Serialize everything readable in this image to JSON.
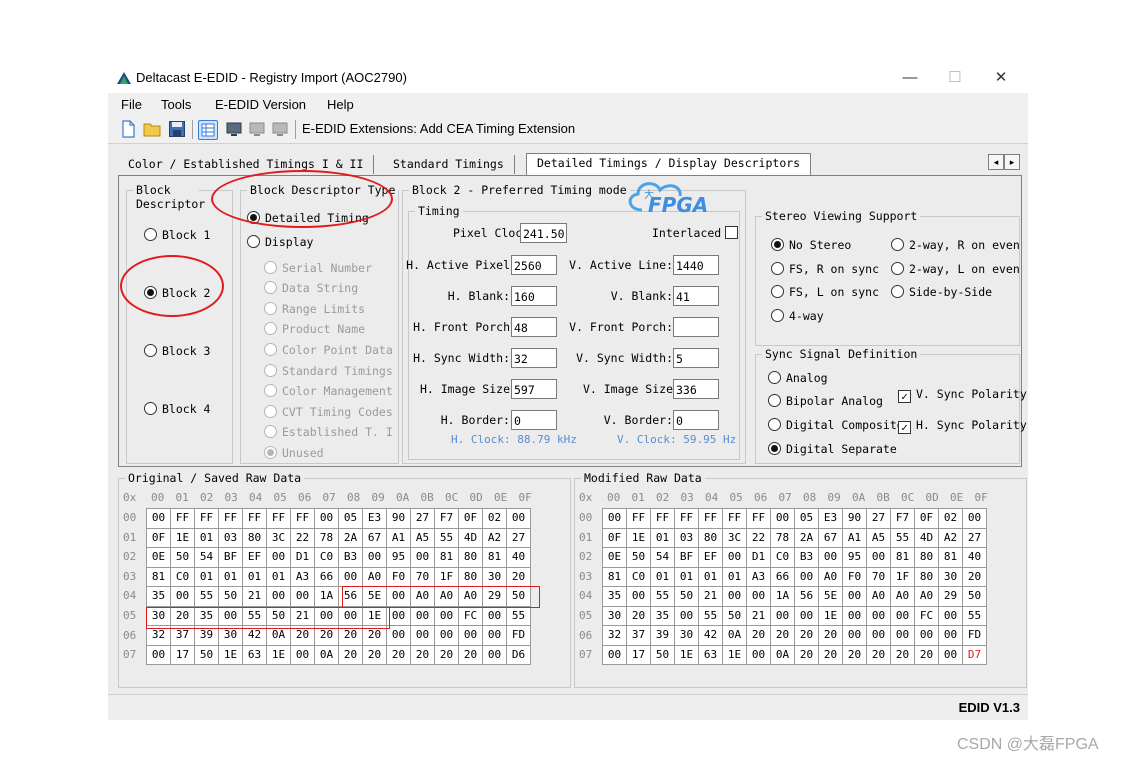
{
  "window": {
    "title": "Deltacast E-EDID - Registry Import (AOC2790)",
    "controls": {
      "minimize": "—",
      "maximize": "☐",
      "close": "✕"
    }
  },
  "menu": [
    "File",
    "Tools",
    "E-EDID Version",
    "Help"
  ],
  "toolbar": {
    "icons": [
      "new-file-icon",
      "open-folder-icon",
      "save-icon",
      "grid-view-icon",
      "monitor-icon",
      "display-grey-icon",
      "display-grey-icon"
    ],
    "extensions_label": "E-EDID Extensions:  Add CEA Timing Extension"
  },
  "tabs": [
    "Color / Established Timings I & II",
    "Standard Timings",
    "Detailed Timings / Display Descriptors"
  ],
  "active_tab": "Detailed Timings / Display Descriptors",
  "block_group": {
    "title": "Block Descriptor",
    "options": [
      "Block 1",
      "Block 2",
      "Block 3",
      "Block 4"
    ],
    "selected": "Block 2"
  },
  "descriptor_type": {
    "title": "Block Descriptor Type",
    "detailed": "Detailed Timing",
    "display": "Display",
    "display_options": [
      "Serial Number",
      "Data String",
      "Range Limits",
      "Product Name",
      "Color Point Data",
      "Standard Timings",
      "Color Management",
      "CVT Timing Codes",
      "Established T. II",
      "Unused"
    ],
    "selected_display": "Unused"
  },
  "block2": {
    "title": "Block 2 -  Preferred Timing mode",
    "timing_title": "Timing",
    "pixel_clock_label": "Pixel Clock",
    "pixel_clock": "241.50",
    "interlaced_label": "Interlaced",
    "interlaced": false,
    "h_fields": [
      {
        "label": "H. Active Pixel",
        "value": "2560"
      },
      {
        "label": "H. Blank:",
        "value": "160"
      },
      {
        "label": "H. Front Porch",
        "value": "48"
      },
      {
        "label": "H. Sync Width:",
        "value": "32"
      },
      {
        "label": "H. Image Size",
        "value": "597"
      },
      {
        "label": "H. Border:",
        "value": "0"
      }
    ],
    "v_fields": [
      {
        "label": "V. Active Line:",
        "value": "1440"
      },
      {
        "label": "V. Blank:",
        "value": "41"
      },
      {
        "label": "V. Front Porch:",
        "value": ""
      },
      {
        "label": "V. Sync Width:",
        "value": "5"
      },
      {
        "label": "V. Image Size",
        "value": "336"
      },
      {
        "label": "V. Border:",
        "value": "0"
      }
    ],
    "h_clock": "H. Clock: 88.79 kHz",
    "v_clock": "V. Clock: 59.95 Hz"
  },
  "stereo": {
    "title": "Stereo Viewing Support",
    "options": [
      "No Stereo",
      "FS, R on sync",
      "FS, L on sync",
      "4-way",
      "2-way, R on even",
      "2-way, L on even",
      "Side-by-Side"
    ],
    "selected": "No Stereo"
  },
  "sync": {
    "title": "Sync Signal Definition",
    "options": [
      "Analog",
      "Bipolar Analog",
      "Digital Composite",
      "Digital Separate"
    ],
    "selected": "Digital Separate",
    "v_polarity_label": "V. Sync Polarity",
    "v_polarity": true,
    "h_polarity_label": "H. Sync Polarity",
    "h_polarity": true
  },
  "hex_columns": [
    "0x",
    "00",
    "01",
    "02",
    "03",
    "04",
    "05",
    "06",
    "07",
    "08",
    "09",
    "0A",
    "0B",
    "0C",
    "0D",
    "0E",
    "0F"
  ],
  "hex_rows": [
    "00",
    "01",
    "02",
    "03",
    "04",
    "05",
    "06",
    "07"
  ],
  "original": {
    "title": "Original / Saved Raw Data",
    "rows": [
      [
        "00",
        "FF",
        "FF",
        "FF",
        "FF",
        "FF",
        "FF",
        "00",
        "05",
        "E3",
        "90",
        "27",
        "F7",
        "0F",
        "02",
        "00"
      ],
      [
        "0F",
        "1E",
        "01",
        "03",
        "80",
        "3C",
        "22",
        "78",
        "2A",
        "67",
        "A1",
        "A5",
        "55",
        "4D",
        "A2",
        "27"
      ],
      [
        "0E",
        "50",
        "54",
        "BF",
        "EF",
        "00",
        "D1",
        "C0",
        "B3",
        "00",
        "95",
        "00",
        "81",
        "80",
        "81",
        "40"
      ],
      [
        "81",
        "C0",
        "01",
        "01",
        "01",
        "01",
        "A3",
        "66",
        "00",
        "A0",
        "F0",
        "70",
        "1F",
        "80",
        "30",
        "20"
      ],
      [
        "35",
        "00",
        "55",
        "50",
        "21",
        "00",
        "00",
        "1A",
        "56",
        "5E",
        "00",
        "A0",
        "A0",
        "A0",
        "29",
        "50"
      ],
      [
        "30",
        "20",
        "35",
        "00",
        "55",
        "50",
        "21",
        "00",
        "00",
        "1E",
        "00",
        "00",
        "00",
        "FC",
        "00",
        "55"
      ],
      [
        "32",
        "37",
        "39",
        "30",
        "42",
        "0A",
        "20",
        "20",
        "20",
        "20",
        "00",
        "00",
        "00",
        "00",
        "00",
        "FD"
      ],
      [
        "00",
        "17",
        "50",
        "1E",
        "63",
        "1E",
        "00",
        "0A",
        "20",
        "20",
        "20",
        "20",
        "20",
        "20",
        "00",
        "D6"
      ]
    ]
  },
  "modified": {
    "title": "Modified Raw Data",
    "rows": [
      [
        "00",
        "FF",
        "FF",
        "FF",
        "FF",
        "FF",
        "FF",
        "00",
        "05",
        "E3",
        "90",
        "27",
        "F7",
        "0F",
        "02",
        "00"
      ],
      [
        "0F",
        "1E",
        "01",
        "03",
        "80",
        "3C",
        "22",
        "78",
        "2A",
        "67",
        "A1",
        "A5",
        "55",
        "4D",
        "A2",
        "27"
      ],
      [
        "0E",
        "50",
        "54",
        "BF",
        "EF",
        "00",
        "D1",
        "C0",
        "B3",
        "00",
        "95",
        "00",
        "81",
        "80",
        "81",
        "40"
      ],
      [
        "81",
        "C0",
        "01",
        "01",
        "01",
        "01",
        "A3",
        "66",
        "00",
        "A0",
        "F0",
        "70",
        "1F",
        "80",
        "30",
        "20"
      ],
      [
        "35",
        "00",
        "55",
        "50",
        "21",
        "00",
        "00",
        "1A",
        "56",
        "5E",
        "00",
        "A0",
        "A0",
        "A0",
        "29",
        "50"
      ],
      [
        "30",
        "20",
        "35",
        "00",
        "55",
        "50",
        "21",
        "00",
        "00",
        "1E",
        "00",
        "00",
        "00",
        "FC",
        "00",
        "55"
      ],
      [
        "32",
        "37",
        "39",
        "30",
        "42",
        "0A",
        "20",
        "20",
        "20",
        "20",
        "00",
        "00",
        "00",
        "00",
        "00",
        "FD"
      ],
      [
        "00",
        "17",
        "50",
        "1E",
        "63",
        "1E",
        "00",
        "0A",
        "20",
        "20",
        "20",
        "20",
        "20",
        "20",
        "00",
        "D7"
      ]
    ],
    "changed_cell": "D7"
  },
  "status": {
    "edid_version": "EDID V1.3"
  },
  "watermark": {
    "logo_text": "FPGA",
    "logo_char": "大",
    "credit": "CSDN @大磊FPGA"
  },
  "colors": {
    "annotation": "#e01b1b",
    "clock_text": "#5b8bd0",
    "changed_byte": "#e0201a"
  }
}
